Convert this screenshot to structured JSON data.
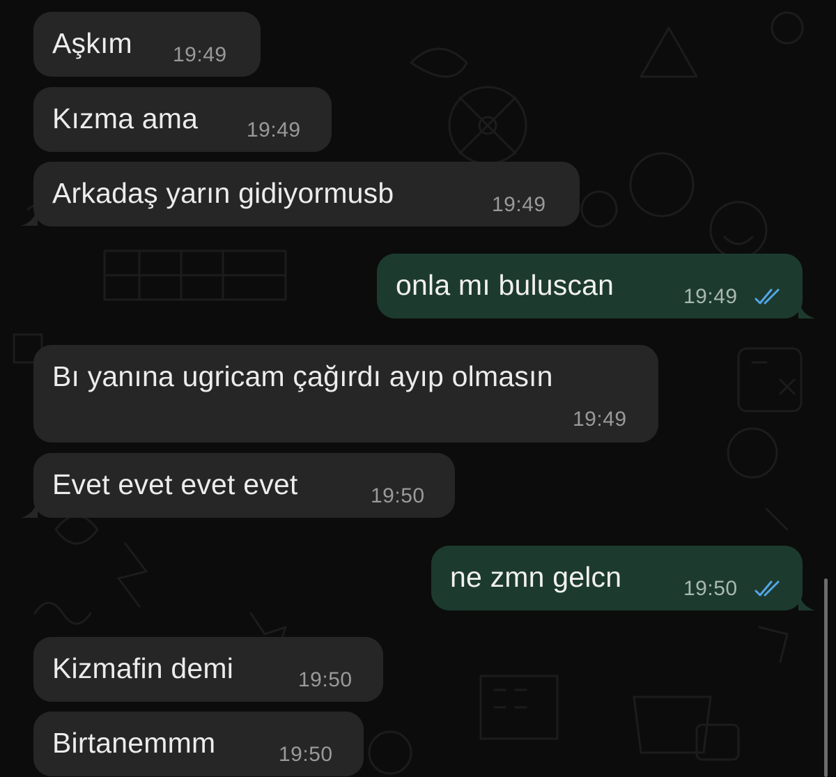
{
  "colors": {
    "background": "#0c0c0c",
    "incoming_bubble": "#262626",
    "outgoing_bubble": "#1d3a2e",
    "read_tick": "#53a6e8"
  },
  "messages": [
    {
      "direction": "incoming",
      "text": "Aşkım",
      "time": "19:49"
    },
    {
      "direction": "incoming",
      "text": "Kızma ama",
      "time": "19:49"
    },
    {
      "direction": "incoming",
      "text": "Arkadaş yarın gidiyormusb",
      "time": "19:49"
    },
    {
      "direction": "outgoing",
      "text": "onla mı buluscan",
      "time": "19:49",
      "status_icon": "double-check-read-icon"
    },
    {
      "direction": "incoming",
      "text": "Bı yanına ugricam çağırdı ayıp olmasın",
      "time": "19:49"
    },
    {
      "direction": "incoming",
      "text": "Evet evet evet evet",
      "time": "19:50"
    },
    {
      "direction": "outgoing",
      "text": "ne zmn gelcn",
      "time": "19:50",
      "status_icon": "double-check-read-icon"
    },
    {
      "direction": "incoming",
      "text": "Kizmafin demi",
      "time": "19:50"
    },
    {
      "direction": "incoming",
      "text": "Birtanemmm",
      "time": "19:50"
    }
  ]
}
